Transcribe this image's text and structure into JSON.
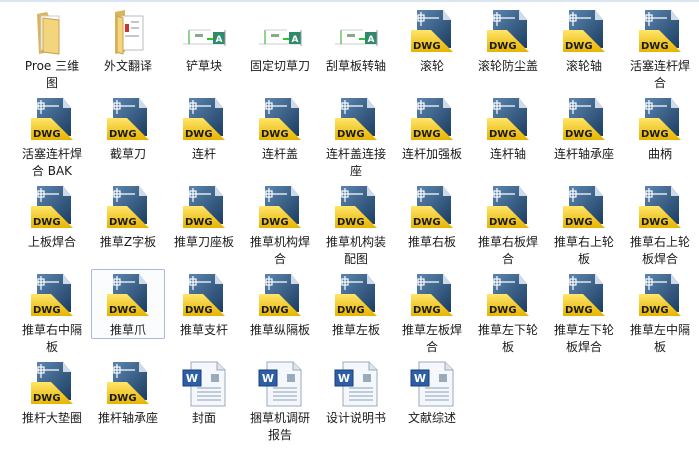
{
  "selected": "推草爪",
  "items": [
    {
      "label": "Proe 三维图",
      "type": "folder"
    },
    {
      "label": "外文翻译",
      "type": "folder-docs"
    },
    {
      "label": "铲草块",
      "type": "dwg-thumb"
    },
    {
      "label": "固定切草刀",
      "type": "dwg-thumb"
    },
    {
      "label": "刮草板转轴",
      "type": "dwg-thumb"
    },
    {
      "label": "滚轮",
      "type": "dwg"
    },
    {
      "label": "滚轮防尘盖",
      "type": "dwg"
    },
    {
      "label": "滚轮轴",
      "type": "dwg"
    },
    {
      "label": "活塞连杆焊合",
      "type": "dwg"
    },
    {
      "label": "活塞连杆焊合 BAK",
      "type": "dwg"
    },
    {
      "label": "截草刀",
      "type": "dwg"
    },
    {
      "label": "连杆",
      "type": "dwg"
    },
    {
      "label": "连杆盖",
      "type": "dwg"
    },
    {
      "label": "连杆盖连接座",
      "type": "dwg"
    },
    {
      "label": "连杆加强板",
      "type": "dwg"
    },
    {
      "label": "连杆轴",
      "type": "dwg"
    },
    {
      "label": "连杆轴承座",
      "type": "dwg"
    },
    {
      "label": "曲柄",
      "type": "dwg"
    },
    {
      "label": "上板焊合",
      "type": "dwg"
    },
    {
      "label": "推草Z字板",
      "type": "dwg"
    },
    {
      "label": "推草刀座板",
      "type": "dwg"
    },
    {
      "label": "推草机构焊合",
      "type": "dwg"
    },
    {
      "label": "推草机构装配图",
      "type": "dwg"
    },
    {
      "label": "推草右板",
      "type": "dwg"
    },
    {
      "label": "推草右板焊合",
      "type": "dwg"
    },
    {
      "label": "推草右上轮板",
      "type": "dwg"
    },
    {
      "label": "推草右上轮板焊合",
      "type": "dwg"
    },
    {
      "label": "推草右中隔板",
      "type": "dwg"
    },
    {
      "label": "推草爪",
      "type": "dwg"
    },
    {
      "label": "推草支杆",
      "type": "dwg"
    },
    {
      "label": "推草纵隔板",
      "type": "dwg"
    },
    {
      "label": "推草左板",
      "type": "dwg"
    },
    {
      "label": "推草左板焊合",
      "type": "dwg"
    },
    {
      "label": "推草左下轮板",
      "type": "dwg"
    },
    {
      "label": "推草左下轮板焊合",
      "type": "dwg"
    },
    {
      "label": "推草左中隔板",
      "type": "dwg"
    },
    {
      "label": "推杆大垫圈",
      "type": "dwg"
    },
    {
      "label": "推杆轴承座",
      "type": "dwg"
    },
    {
      "label": "封面",
      "type": "word"
    },
    {
      "label": "捆草机调研报告",
      "type": "word"
    },
    {
      "label": "设计说明书",
      "type": "word"
    },
    {
      "label": "文献综述",
      "type": "word"
    }
  ],
  "dwg_badge": "DWG",
  "colors": {
    "dwg_blue": "#2f5a85",
    "dwg_yellow": "#f2c200",
    "folder": "#f3d57e",
    "selection": "#a8bcd8"
  }
}
